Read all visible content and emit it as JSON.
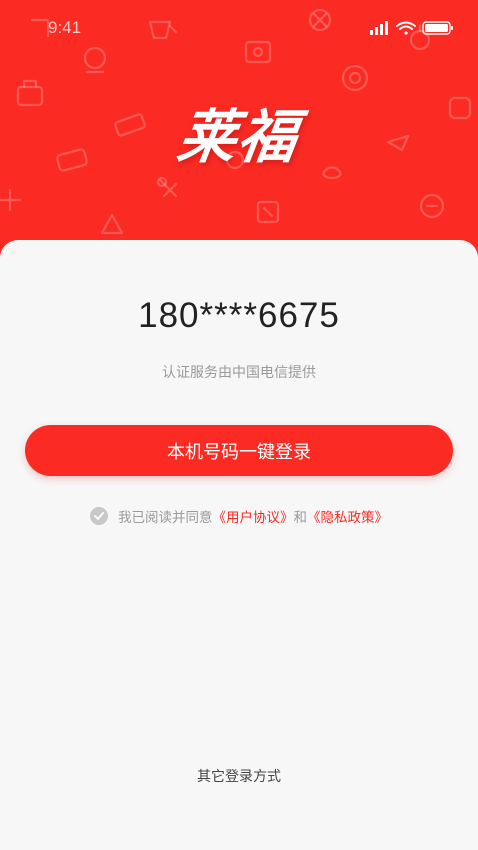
{
  "status_bar": {
    "time": "9:41"
  },
  "brand": {
    "logo_text": "莱福"
  },
  "login": {
    "phone_number": "180****6675",
    "provider_note": "认证服务由中国电信提供",
    "one_click_label": "本机号码一键登录"
  },
  "agreement": {
    "prefix": "我已阅读并同意",
    "user_agreement": "《用户协议》",
    "and": "和",
    "privacy_policy": "《隐私政策》"
  },
  "other_login_label": "其它登录方式",
  "colors": {
    "accent": "#fb2b24",
    "background": "#f7f7f7",
    "muted": "#9a9a9a"
  },
  "icons": [
    "signal-icon",
    "wifi-icon",
    "battery-icon",
    "checkbox-icon"
  ]
}
